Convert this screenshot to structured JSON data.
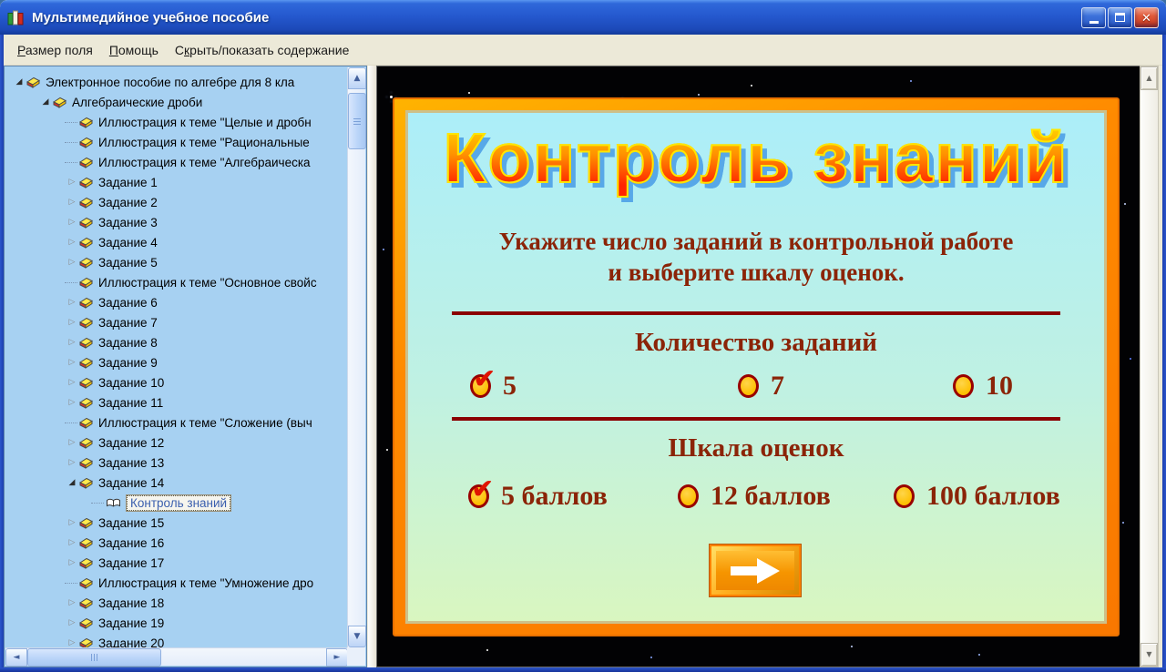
{
  "window": {
    "title": "Мультимедийное учебное пособие"
  },
  "menu": {
    "items": [
      {
        "label": "Размер поля",
        "underline_index": 0
      },
      {
        "label": "Помощь",
        "underline_index": 0
      },
      {
        "label": "Скрыть/показать содержание",
        "underline_index": 1
      }
    ]
  },
  "tree": {
    "items": [
      {
        "label": "Электронное пособие по алгебре для 8 кла",
        "level": 0,
        "state": "expanded"
      },
      {
        "label": "Алгебраические дроби",
        "level": 1,
        "state": "expanded"
      },
      {
        "label": "Иллюстрация к теме \"Целые и дробн",
        "level": 2,
        "state": "leaf"
      },
      {
        "label": "Иллюстрация к теме \"Рациональные",
        "level": 2,
        "state": "leaf"
      },
      {
        "label": "Иллюстрация к теме \"Алгебраическа",
        "level": 2,
        "state": "leaf"
      },
      {
        "label": "Задание 1",
        "level": 2,
        "state": "collapsed"
      },
      {
        "label": "Задание 2",
        "level": 2,
        "state": "collapsed"
      },
      {
        "label": "Задание 3",
        "level": 2,
        "state": "collapsed"
      },
      {
        "label": "Задание 4",
        "level": 2,
        "state": "collapsed"
      },
      {
        "label": "Задание 5",
        "level": 2,
        "state": "collapsed"
      },
      {
        "label": "Иллюстрация к теме \"Основное свойс",
        "level": 2,
        "state": "leaf"
      },
      {
        "label": "Задание 6",
        "level": 2,
        "state": "collapsed"
      },
      {
        "label": "Задание 7",
        "level": 2,
        "state": "collapsed"
      },
      {
        "label": "Задание 8",
        "level": 2,
        "state": "collapsed"
      },
      {
        "label": "Задание 9",
        "level": 2,
        "state": "collapsed"
      },
      {
        "label": "Задание 10",
        "level": 2,
        "state": "collapsed"
      },
      {
        "label": "Задание 11",
        "level": 2,
        "state": "collapsed"
      },
      {
        "label": "Иллюстрация к теме \"Сложение (выч",
        "level": 2,
        "state": "leaf"
      },
      {
        "label": "Задание 12",
        "level": 2,
        "state": "collapsed"
      },
      {
        "label": "Задание 13",
        "level": 2,
        "state": "collapsed"
      },
      {
        "label": "Задание 14",
        "level": 2,
        "state": "expanded"
      },
      {
        "label": "Контроль знаний",
        "level": 3,
        "state": "leaf",
        "selected": true,
        "icon": "open-book"
      },
      {
        "label": "Задание 15",
        "level": 2,
        "state": "collapsed"
      },
      {
        "label": "Задание 16",
        "level": 2,
        "state": "collapsed"
      },
      {
        "label": "Задание 17",
        "level": 2,
        "state": "collapsed"
      },
      {
        "label": "Иллюстрация к теме \"Умножение дро",
        "level": 2,
        "state": "leaf"
      },
      {
        "label": "Задание 18",
        "level": 2,
        "state": "collapsed"
      },
      {
        "label": "Задание 19",
        "level": 2,
        "state": "collapsed"
      },
      {
        "label": "Задание 20",
        "level": 2,
        "state": "collapsed"
      }
    ]
  },
  "card": {
    "title": "Контроль знаний",
    "instruction_line1": "Укажите число заданий в контрольной работе",
    "instruction_line2": "и выберите шкалу оценок.",
    "quantity": {
      "heading": "Количество заданий",
      "options": [
        {
          "label": "5",
          "checked": true
        },
        {
          "label": "7",
          "checked": false
        },
        {
          "label": "10",
          "checked": false
        }
      ]
    },
    "scale": {
      "heading": "Шкала оценок",
      "options": [
        {
          "label": "5 баллов",
          "checked": true
        },
        {
          "label": "12 баллов",
          "checked": false
        },
        {
          "label": "100 баллов",
          "checked": false
        }
      ]
    }
  },
  "icons": {
    "app": "books-icon",
    "minimize": "–",
    "maximize": "▢",
    "close": "✕",
    "tree_expanded": "◢",
    "tree_collapsed": "▷",
    "tree_item": "book-icon",
    "selected_item": "open-book-icon",
    "next_button": "arrow-right-icon",
    "check": "✔",
    "scroll_up": "▲",
    "scroll_down": "▼",
    "scroll_left": "◄",
    "scroll_right": "►"
  },
  "colors": {
    "accent_orange": "#ff8200",
    "card_top": "#aceef9",
    "card_bottom": "#d9f6c0",
    "heading_red": "#8b2408",
    "divider_red": "#8b0000",
    "radio_gold": "#fdbf00",
    "radio_border": "#990000",
    "title_shadow_blue": "#57a8e8",
    "tree_bg": "#a7d1f2",
    "selected_text": "#3b5fae"
  }
}
